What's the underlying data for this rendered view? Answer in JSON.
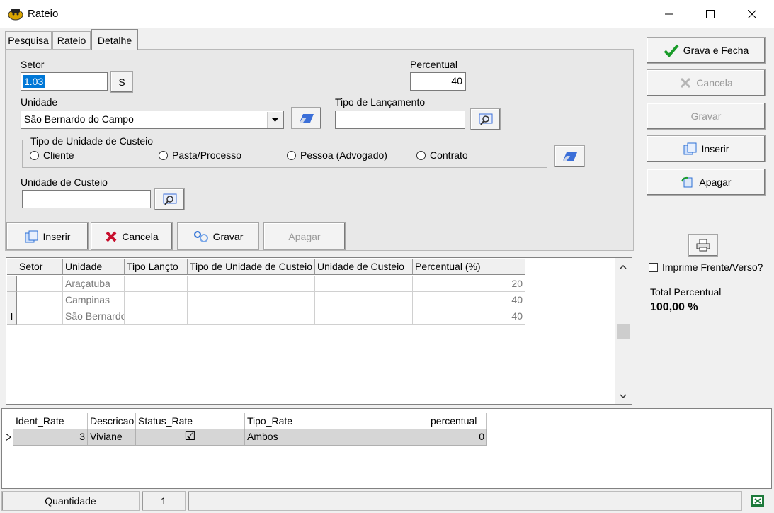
{
  "window": {
    "title": "Rateio",
    "controls": [
      "—",
      "☐",
      "✕"
    ]
  },
  "tabs": [
    {
      "label": "Pesquisa"
    },
    {
      "label": "Rateio"
    },
    {
      "label": "Detalhe"
    }
  ],
  "form": {
    "setor_label": "Setor",
    "setor_value": "1.03",
    "setor_btn": "S",
    "percentual_label": "Percentual",
    "percentual_value": "40",
    "unidade_label": "Unidade",
    "unidade_value": "São Bernardo do Campo",
    "tipo_lanc_label": "Tipo de Lançamento",
    "tipo_lanc_value": "",
    "tipo_unidade_group": "Tipo de Unidade de Custeio",
    "radios": [
      {
        "label": "Cliente"
      },
      {
        "label": "Pasta/Processo"
      },
      {
        "label": "Pessoa (Advogado)"
      },
      {
        "label": "Contrato"
      }
    ],
    "unidade_custeio_label": "Unidade de Custeio",
    "unidade_custeio_value": ""
  },
  "action_buttons": {
    "inserir": "Inserir",
    "cancela": "Cancela",
    "gravar": "Gravar",
    "apagar": "Apagar"
  },
  "grid1": {
    "columns": [
      "Setor",
      "Unidade",
      "Tipo Lançto",
      "Tipo de Unidade de Custeio",
      "Unidade de Custeio",
      "Percentual (%)"
    ],
    "rows": [
      {
        "setor": "",
        "unidade": "Araçatuba",
        "tipo": "",
        "tipo_unidade": "",
        "unidade_custeio": "",
        "percentual": "20"
      },
      {
        "setor": "",
        "unidade": "Campinas",
        "tipo": "",
        "tipo_unidade": "",
        "unidade_custeio": "",
        "percentual": "40"
      },
      {
        "setor": "",
        "unidade": "São Bernardo",
        "tipo": "",
        "tipo_unidade": "",
        "unidade_custeio": "",
        "percentual": "40"
      }
    ]
  },
  "grid2": {
    "columns": [
      "Ident_Rate",
      "Descricao",
      "Status_Rate",
      "Tipo_Rate",
      "percentual"
    ],
    "row": {
      "ident_rate": "3",
      "descricao": "Viviane",
      "status_rate": "☑",
      "tipo_rate": "Ambos",
      "percentual": "0"
    }
  },
  "right_panel": {
    "grava_fecha": "Grava e Fecha",
    "cancela": "Cancela",
    "gravar": "Gravar",
    "inserir": "Inserir",
    "apagar": "Apagar",
    "imprime_label": "Imprime Frente/Verso?",
    "total_label": "Total Percentual",
    "total_value": "100,00 %"
  },
  "status_bar": {
    "quantidade_label": "Quantidade",
    "quantidade_value": "1"
  },
  "colors": {
    "accent_green": "#1a9c2a",
    "cancel_red": "#c8102e",
    "icon_blue": "#2b6fd6"
  }
}
